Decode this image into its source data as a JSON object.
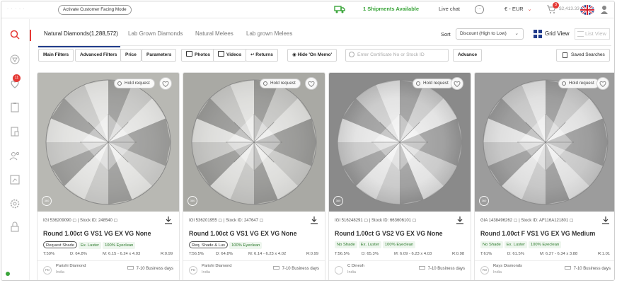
{
  "topbar": {
    "customer_mode_label": "Activate Customer Facing Mode",
    "shipments": "1 Shipments Available",
    "live_chat": "Live chat",
    "currency": "€ - EUR",
    "cart_count": "3",
    "cart_amount": "$2,413.33",
    "accent": "#e53935",
    "shipment_color": "#3aa53a"
  },
  "sidebar": {
    "notification_count": "11",
    "items": [
      "search-icon",
      "diamond-icon",
      "heart-icon",
      "clipboard-icon",
      "document-icon",
      "users-icon",
      "report-icon",
      "gear-icon",
      "lock-icon"
    ]
  },
  "tabs": [
    {
      "label": "Natural Diamonds(1,288,572)",
      "active": true
    },
    {
      "label": "Lab Grown Diamonds",
      "active": false
    },
    {
      "label": "Natural Melees",
      "active": false
    },
    {
      "label": "Lab grown Melees",
      "active": false
    }
  ],
  "sort": {
    "label": "Sort",
    "value": "Discount (High to Low)"
  },
  "view": {
    "grid": "Grid View",
    "list": "List View"
  },
  "filters": {
    "main": "Main Filters",
    "advanced": "Advanced Filters",
    "price": "Price",
    "parameters": "Parameters",
    "photos": "Photos",
    "videos": "Videos",
    "returns": "Returns",
    "hide_memo": "Hide 'On Memo'",
    "search_placeholder": "Enter Certificate No or Stock ID",
    "advance": "Advance",
    "saved": "Saved Searches"
  },
  "cards": [
    {
      "hold": "Hold request",
      "cert": "IGI 536209090",
      "stock": "Stock ID: 248540",
      "title": "Round 1.00ct G VS1 VG EX VG None",
      "tags": [
        {
          "text": "Request Shade",
          "outlined": true
        },
        {
          "text": "Ex. Luster",
          "outlined": false
        },
        {
          "text": "100% Eyeclean",
          "outlined": false
        }
      ],
      "t": "T:59%",
      "d": "D: 64.8%",
      "m": "M: 6.15 - 6.24 x 4.03",
      "r": "R:0.99",
      "seller": "Parishi Diamond",
      "country": "India",
      "seller_initials": "PD",
      "delivery": "7-10 Business days"
    },
    {
      "hold": "Hold request",
      "cert": "IGI 536201955",
      "stock": "Stock ID: 247647",
      "title": "Round 1.00ct G VS1 VG EX VG None",
      "tags": [
        {
          "text": "Req. Shade & Lus",
          "outlined": true
        },
        {
          "text": "100% Eyeclean",
          "outlined": false
        }
      ],
      "t": "T:56.5%",
      "d": "D: 64.8%",
      "m": "M: 6.14 - 6.23 x 4.02",
      "r": "R:0.99",
      "seller": "Parishi Diamond",
      "country": "India",
      "seller_initials": "PD",
      "delivery": "7-10 Business days"
    },
    {
      "hold": "Hold request",
      "cert": "IGI 516248291",
      "stock": "Stock ID: 663606101",
      "title": "Round 1.00ct G VS2 VG EX VG None",
      "tags": [
        {
          "text": "No Shade",
          "outlined": false
        },
        {
          "text": "Ex. Luster",
          "outlined": false
        },
        {
          "text": "100% Eyeclean",
          "outlined": false
        }
      ],
      "t": "T:56.5%",
      "d": "D: 65.3%",
      "m": "M: 6.09 - 6.23 x 4.03",
      "r": "R:0.98",
      "seller": "C Dinesh",
      "country": "India",
      "seller_initials": "",
      "delivery": "7-10 Business days"
    },
    {
      "hold": "Hold request",
      "cert": "GIA 1438496262",
      "stock": "Stock ID: AF116A121801",
      "title": "Round 1.00ct F VS1 VG EX VG Medium",
      "tags": [
        {
          "text": "No Shade",
          "outlined": false
        },
        {
          "text": "Ex. Luster",
          "outlined": false
        },
        {
          "text": "100% Eyeclean",
          "outlined": false
        }
      ],
      "t": "T:61%",
      "d": "D: 61.5%",
      "m": "M: 6.27 - 6.34 x 3.88",
      "r": "R:1.01",
      "seller": "Rays Diamonds",
      "country": "India",
      "seller_initials": "RD",
      "delivery": "7-10 Business days"
    }
  ]
}
